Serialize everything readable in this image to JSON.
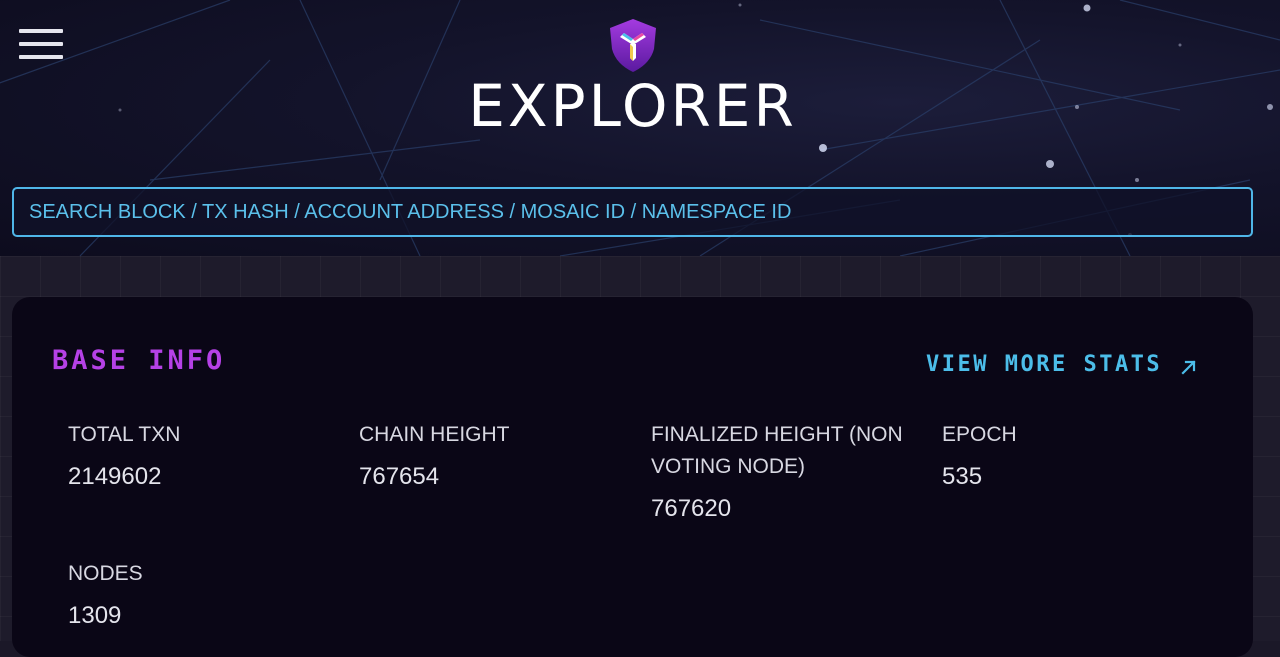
{
  "header": {
    "title": "EXPLORER",
    "logo_icon": "symbol-shield-logo",
    "menu_icon": "hamburger-menu-icon"
  },
  "search": {
    "placeholder": "SEARCH BLOCK / TX HASH / ACCOUNT ADDRESS / MOSAIC ID / NAMESPACE ID",
    "value": ""
  },
  "base_info": {
    "title": "BASE INFO",
    "view_more_label": "VIEW MORE STATS",
    "view_more_icon": "arrow-up-right-icon",
    "stats": [
      {
        "label": "TOTAL TXN",
        "value": "2149602"
      },
      {
        "label": "CHAIN HEIGHT",
        "value": "767654"
      },
      {
        "label": "FINALIZED HEIGHT (NON VOTING NODE)",
        "value": "767620"
      },
      {
        "label": "EPOCH",
        "value": "535"
      },
      {
        "label": "NODES",
        "value": "1309"
      }
    ]
  },
  "colors": {
    "accent_purple": "#b541e6",
    "accent_blue": "#4cbde9",
    "card_background": "#0a0616",
    "page_background": "#1e1b2b"
  }
}
